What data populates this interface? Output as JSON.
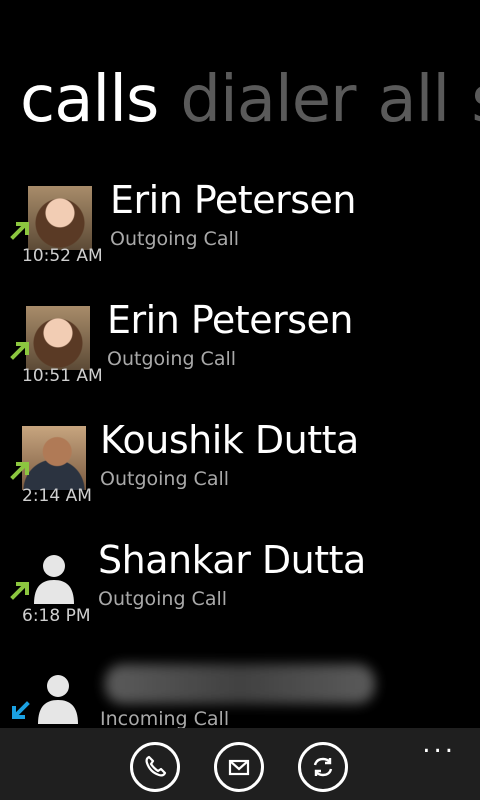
{
  "pivot": {
    "active": "calls",
    "tabs": [
      "dialer",
      "all",
      "s"
    ]
  },
  "calls": [
    {
      "time": "10:52 AM",
      "name": "Erin Petersen",
      "type": "Outgoing Call",
      "direction": "outgoing",
      "avatar": "photo-erin"
    },
    {
      "time": "10:51 AM",
      "name": "Erin Petersen",
      "type": "Outgoing Call",
      "direction": "outgoing",
      "avatar": "photo-erin"
    },
    {
      "time": "2:14 AM",
      "name": "Koushik Dutta",
      "type": "Outgoing Call",
      "direction": "outgoing",
      "avatar": "photo-koushik"
    },
    {
      "time": "6:18 PM",
      "name": "Shankar Dutta",
      "type": "Outgoing Call",
      "direction": "outgoing",
      "avatar": "placeholder"
    },
    {
      "time": "",
      "name": "",
      "type": "Incoming Call",
      "direction": "incoming",
      "avatar": "placeholder"
    }
  ],
  "appbar": {
    "buttons": [
      "phone-icon",
      "voicemail-icon",
      "sync-icon"
    ],
    "more": "..."
  },
  "colors": {
    "outgoing_arrow": "#8cc63f",
    "incoming_arrow": "#1ba1e2",
    "inactive_tab": "#5a5a5a"
  }
}
